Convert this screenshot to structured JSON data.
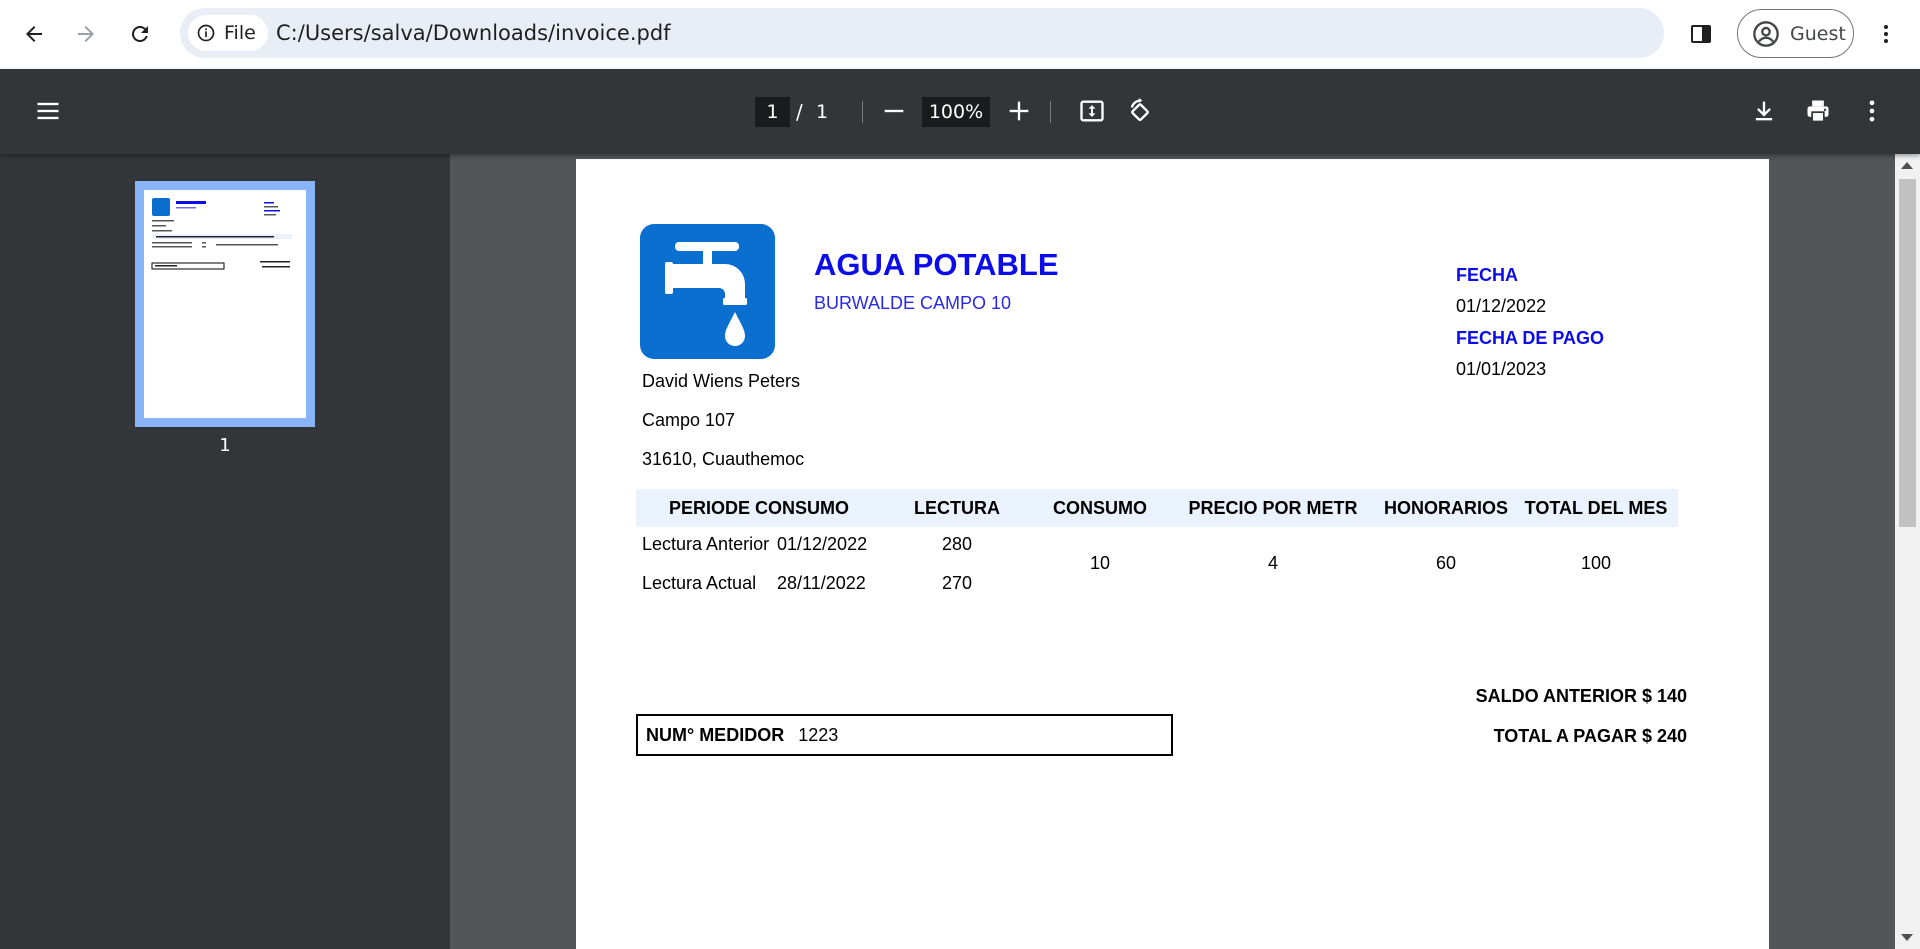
{
  "browser": {
    "chip_label": "File",
    "url": "C:/Users/salva/Downloads/invoice.pdf",
    "profile_label": "Guest"
  },
  "pdf_toolbar": {
    "current_page": "1",
    "separator": "/",
    "total_pages": "1",
    "zoom": "100%"
  },
  "sidebar": {
    "thumbnail_label": "1"
  },
  "invoice": {
    "company_name": "AGUA POTABLE",
    "company_subtitle": "BURWALDE CAMPO 10",
    "fecha_label": "FECHA",
    "fecha_value": "01/12/2022",
    "fecha_pago_label": "FECHA DE PAGO",
    "fecha_pago_value": "01/01/2023",
    "client": {
      "name": "David Wiens Peters",
      "address": "Campo 107",
      "city": "31610, Cuauthemoc"
    },
    "table": {
      "headers": [
        "PERIODE CONSUMO",
        "LECTURA",
        "CONSUMO",
        "PRECIO POR METR",
        "HONORARIOS",
        "TOTAL DEL MES"
      ],
      "rows": [
        {
          "label": "Lectura Anterior",
          "date": "01/12/2022",
          "reading": "280"
        },
        {
          "label": "Lectura Actual",
          "date": "28/11/2022",
          "reading": "270"
        }
      ],
      "consumo": "10",
      "precio": "4",
      "honorarios": "60",
      "total_mes": "100"
    },
    "meter_label": "NUM° MEDIDOR",
    "meter_value": "1223",
    "saldo_anterior": "SALDO ANTERIOR $ 140",
    "total_pagar": "TOTAL A PAGAR $ 240"
  },
  "colors": {
    "brand_blue": "#0c0ceb",
    "logo_blue": "#0b6fd0",
    "table_header_bg": "#eaf3fd",
    "toolbar_bg": "#323639",
    "viewer_bg": "#525659"
  },
  "icons": [
    "back-icon",
    "forward-icon",
    "reload-icon",
    "info-icon",
    "side-panel-icon",
    "profile-icon",
    "kebab-menu-icon",
    "hamburger-menu-icon",
    "zoom-out-icon",
    "zoom-in-icon",
    "fit-page-icon",
    "rotate-icon",
    "download-icon",
    "print-icon",
    "faucet-icon"
  ]
}
